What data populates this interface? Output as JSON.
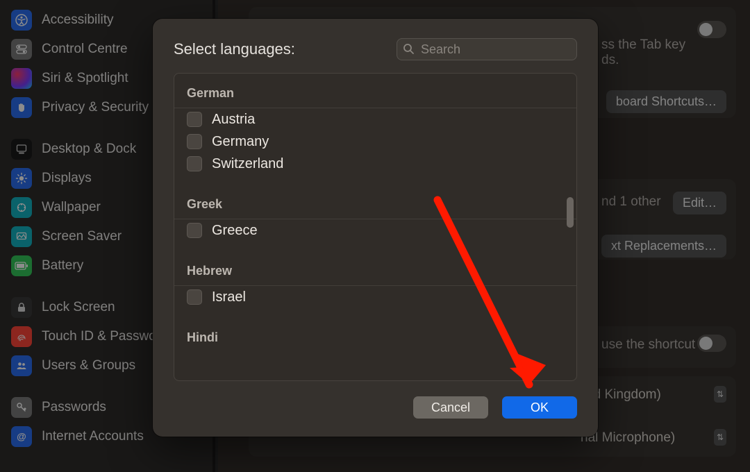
{
  "sidebar": {
    "items": [
      {
        "label": "Accessibility",
        "icon": "accessibility"
      },
      {
        "label": "Control Centre",
        "icon": "control-centre"
      },
      {
        "label": "Siri & Spotlight",
        "icon": "siri"
      },
      {
        "label": "Privacy & Security",
        "icon": "privacy"
      },
      {
        "label": "Desktop & Dock",
        "icon": "desktop-dock"
      },
      {
        "label": "Displays",
        "icon": "displays"
      },
      {
        "label": "Wallpaper",
        "icon": "wallpaper"
      },
      {
        "label": "Screen Saver",
        "icon": "screen-saver"
      },
      {
        "label": "Battery",
        "icon": "battery"
      },
      {
        "label": "Lock Screen",
        "icon": "lock-screen"
      },
      {
        "label": "Touch ID & Password",
        "icon": "touch-id"
      },
      {
        "label": "Users & Groups",
        "icon": "users-groups"
      },
      {
        "label": "Passwords",
        "icon": "passwords"
      },
      {
        "label": "Internet Accounts",
        "icon": "internet-accounts"
      }
    ]
  },
  "background": {
    "tab_hint": "ss the Tab key\nds.",
    "shortcuts_button": "board Shortcuts…",
    "other_text": "nd 1 other",
    "edit_button": "Edit…",
    "text_repl_button": "xt Replacements…",
    "shortcut_hint": "use the shortcut",
    "keyboard_lang": "nited Kingdom)",
    "mic_label": "nal Microphone)"
  },
  "modal": {
    "title": "Select languages:",
    "search_placeholder": "Search",
    "groups": [
      {
        "name": "German",
        "items": [
          "Austria",
          "Germany",
          "Switzerland"
        ]
      },
      {
        "name": "Greek",
        "items": [
          "Greece"
        ]
      },
      {
        "name": "Hebrew",
        "items": [
          "Israel"
        ]
      },
      {
        "name": "Hindi",
        "items": []
      }
    ],
    "cancel_label": "Cancel",
    "ok_label": "OK"
  },
  "annotation": {
    "arrow_color": "#ff1a00"
  }
}
